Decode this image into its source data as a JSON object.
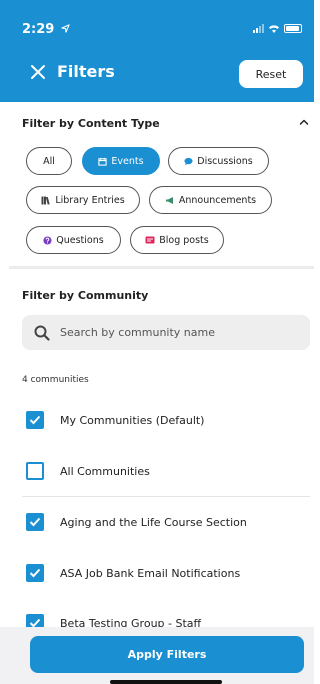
{
  "status_bar": {
    "time": "2:29"
  },
  "header": {
    "title": "Filters",
    "reset_label": "Reset"
  },
  "content_type": {
    "title": "Filter by Content Type",
    "chips": [
      {
        "label": "All",
        "active": false,
        "icon": ""
      },
      {
        "label": "Events",
        "active": true,
        "icon": "calendar-icon"
      },
      {
        "label": "Discussions",
        "active": false,
        "icon": "speech-bubble-icon"
      },
      {
        "label": "Library Entries",
        "active": false,
        "icon": "books-icon"
      },
      {
        "label": "Announcements",
        "active": false,
        "icon": "megaphone-icon"
      },
      {
        "label": "Questions",
        "active": false,
        "icon": "question-circle-icon"
      },
      {
        "label": "Blog posts",
        "active": false,
        "icon": "blog-icon"
      }
    ]
  },
  "community": {
    "title": "Filter by Community",
    "search_placeholder": "Search by community name",
    "count_label": "4 communities",
    "items": [
      {
        "label": "My Communities (Default)",
        "checked": true
      },
      {
        "label": "All Communities",
        "checked": false
      },
      {
        "label": "Aging and the Life Course Section",
        "checked": true
      },
      {
        "label": "ASA Job Bank Email Notifications",
        "checked": true
      },
      {
        "label": "Beta Testing Group - Staff",
        "checked": true
      }
    ]
  },
  "footer": {
    "apply_label": "Apply Filters"
  },
  "colors": {
    "accent": "#1a8fd1",
    "discussions_icon": "#1a8fd1",
    "questions_icon": "#7a3cc8",
    "blog_icon": "#e0245e",
    "announcements_icon": "#3a8f6b",
    "library_icon": "#444444"
  }
}
